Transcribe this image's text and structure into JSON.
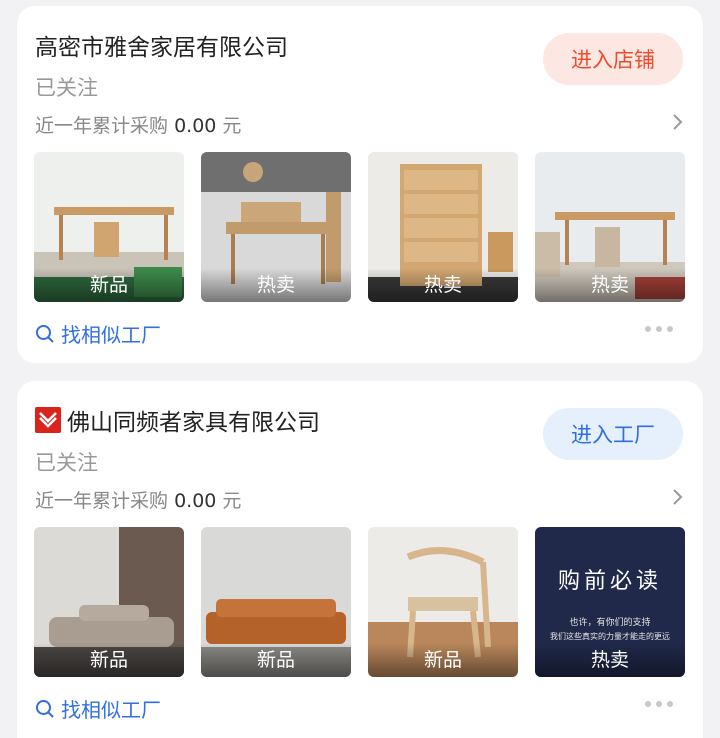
{
  "cards": [
    {
      "company": "高密市雅舍家居有限公司",
      "follow_status": "已关注",
      "stat_label": "近一年累计采购",
      "stat_value": "0.00",
      "stat_unit": "元",
      "enter_label": "进入店铺",
      "thumb_tags": [
        "新品",
        "热卖",
        "热卖",
        "热卖"
      ],
      "find_label": "找相似工厂"
    },
    {
      "company": "佛山同频者家具有限公司",
      "follow_status": "已关注",
      "stat_label": "近一年累计采购",
      "stat_value": "0.00",
      "stat_unit": "元",
      "enter_label": "进入工厂",
      "thumb_tags": [
        "新品",
        "新品",
        "新品",
        "热卖"
      ],
      "thumb4_text": "购前必读",
      "thumb4_sub1": "也许，有你们的支持",
      "thumb4_sub2": "我们这些真实的力量才能走的更远",
      "find_label": "找相似工厂"
    }
  ],
  "colors": {
    "shop_accent": "#ee4b2b",
    "factory_accent": "#2f6fe0",
    "link": "#2f6fe0"
  },
  "icons": [
    "chevron-right-icon",
    "search-icon",
    "more-dots-icon",
    "company-logo-icon"
  ]
}
